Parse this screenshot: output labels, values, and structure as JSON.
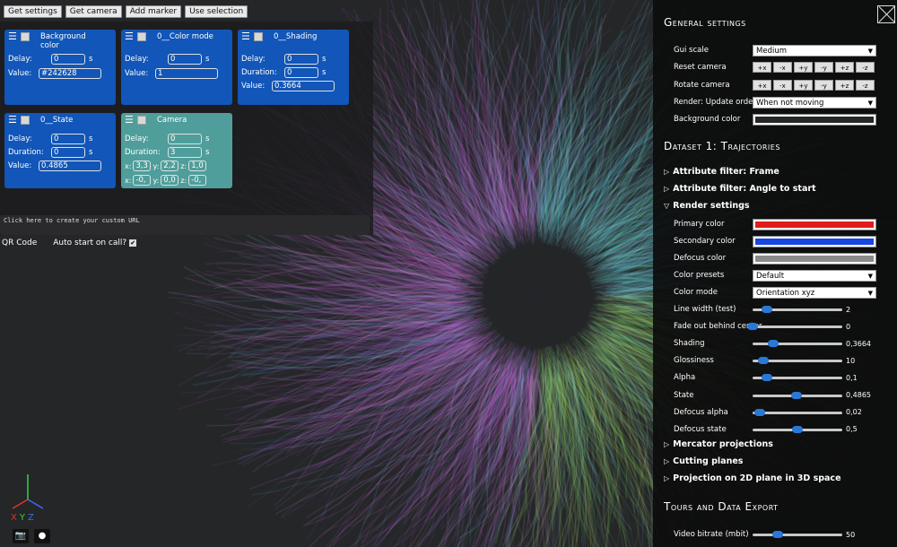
{
  "toolbar": {
    "get_settings": "Get settings",
    "get_camera": "Get camera",
    "add_marker": "Add marker",
    "use_selection": "Use selection"
  },
  "markers": {
    "background": {
      "title": "Background color",
      "delay_label": "Delay:",
      "delay": "0",
      "unit": "s",
      "value_label": "Value:",
      "value": "#242628"
    },
    "color_mode": {
      "title": "0__Color mode",
      "delay_label": "Delay:",
      "delay": "0",
      "unit": "s",
      "value_label": "Value:",
      "value": "1"
    },
    "shading": {
      "title": "0__Shading",
      "delay_label": "Delay:",
      "delay": "0",
      "duration_label": "Duration:",
      "duration": "0",
      "unit": "s",
      "value_label": "Value:",
      "value": "0.3664"
    },
    "state": {
      "title": "0__State",
      "delay_label": "Delay:",
      "delay": "0",
      "duration_label": "Duration:",
      "duration": "0",
      "unit": "s",
      "value_label": "Value:",
      "value": "0.4865"
    },
    "camera": {
      "title": "Camera",
      "delay_label": "Delay:",
      "delay": "0",
      "duration_label": "Duration:",
      "duration": "3",
      "unit": "s",
      "x_label": "x:",
      "y_label": "y:",
      "z_label": "z:",
      "x1": "3,3",
      "y1": "2,2",
      "z1": "1,0",
      "x2": "-0,",
      "y2": "0,0",
      "z2": "-0,"
    }
  },
  "url_placeholder": "Click here to create your custom URL",
  "qr_code": "QR Code",
  "auto_start": "Auto start on call?",
  "auto_start_checked": true,
  "axes": {
    "x": "X",
    "y": "Y",
    "z": "Z",
    "x_color": "#e0322b",
    "y_color": "#3ecf3e",
    "z_color": "#3a6df0"
  },
  "bottom": {
    "camera_icon": "📷",
    "record_icon": "●"
  },
  "general": {
    "title": "General settings",
    "gui_scale_label": "Gui scale",
    "gui_scale": "Medium",
    "reset_camera_label": "Reset camera",
    "rotate_camera_label": "Rotate camera",
    "axis_buttons": [
      "+x",
      "-x",
      "+y",
      "-y",
      "+z",
      "-z"
    ],
    "render_order_label": "Render: Update order",
    "render_order": "When not moving",
    "background_color_label": "Background color",
    "background_color": "#242628"
  },
  "dataset": {
    "title": "Dataset 1: Trajectories",
    "filter_frame": "Attribute filter: Frame",
    "filter_angle": "Attribute filter: Angle to start",
    "render_settings": "Render settings",
    "primary_label": "Primary color",
    "primary_color": "#e01c1c",
    "secondary_label": "Secondary color",
    "secondary_color": "#1846e0",
    "defocus_label": "Defocus color",
    "defocus_color": "#8a8a8a",
    "presets_label": "Color presets",
    "presets": "Default",
    "color_mode_label": "Color mode",
    "color_mode": "Orientation xyz",
    "sliders": [
      {
        "label": "Line width (test)",
        "value": "2",
        "fraction": 0.16
      },
      {
        "label": "Fade out behind center",
        "value": "0",
        "fraction": 0.0
      },
      {
        "label": "Shading",
        "value": "0,3664",
        "fraction": 0.23
      },
      {
        "label": "Glossiness",
        "value": "10",
        "fraction": 0.12
      },
      {
        "label": "Alpha",
        "value": "0,1",
        "fraction": 0.16
      },
      {
        "label": "State",
        "value": "0,4865",
        "fraction": 0.49
      },
      {
        "label": "Defocus alpha",
        "value": "0,02",
        "fraction": 0.08
      },
      {
        "label": "Defocus state",
        "value": "0,5",
        "fraction": 0.5
      }
    ],
    "mercator": "Mercator projections",
    "cutting": "Cutting planes",
    "projection": "Projection on 2D plane in 3D space"
  },
  "tours": {
    "title": "Tours and Data Export",
    "bitrate_label": "Video bitrate (mbit)",
    "bitrate": "50",
    "bitrate_fraction": 0.28
  }
}
